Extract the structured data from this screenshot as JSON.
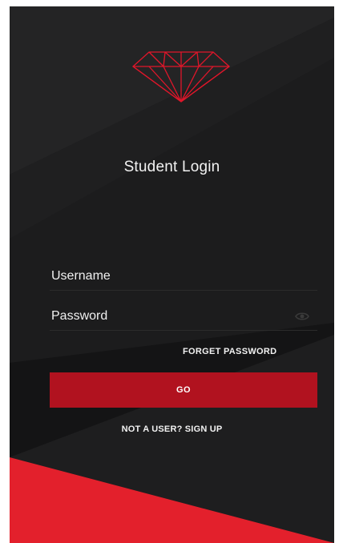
{
  "screen": {
    "title": "Student Login"
  },
  "form": {
    "username_placeholder": "Username",
    "password_placeholder": "Password",
    "forget_password_label": "FORGET PASSWORD",
    "go_label": "GO",
    "signup_label": "NOT A USER? SIGN UP"
  },
  "icons": {
    "logo": "diamond-icon",
    "password_toggle": "eye-icon"
  },
  "colors": {
    "background": "#1c1c1d",
    "accent": "#b1121f",
    "accent_bright": "#e0162a",
    "text": "#f2f2f2"
  }
}
